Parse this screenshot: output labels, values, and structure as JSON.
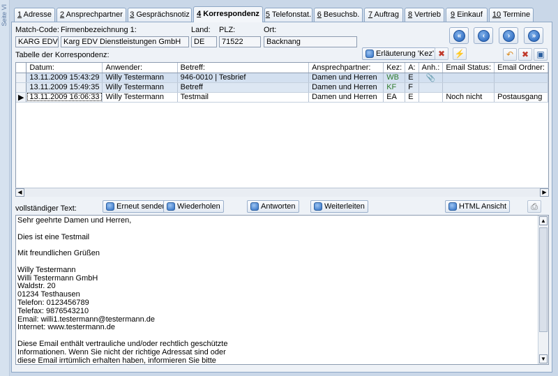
{
  "sidebar": {
    "vertical_text": "Seite VI"
  },
  "tabs": [
    {
      "num": "1",
      "label": "Adresse"
    },
    {
      "num": "2",
      "label": "Ansprechpartner"
    },
    {
      "num": "3",
      "label": "Gesprächsnotiz"
    },
    {
      "num": "4",
      "label": "Korrespondenz"
    },
    {
      "num": "5",
      "label": "Telefonstat."
    },
    {
      "num": "6",
      "label": "Besuchsb."
    },
    {
      "num": "7",
      "label": "Auftrag"
    },
    {
      "num": "8",
      "label": "Vertrieb"
    },
    {
      "num": "9",
      "label": "Einkauf"
    },
    {
      "num": "10",
      "label": "Termine"
    }
  ],
  "header": {
    "matchcode_label": "Match-Code:",
    "matchcode_value": "KARG EDV",
    "firma_label": "Firmenbezeichnung 1:",
    "firma_value": "Karg EDV Dienstleistungen GmbH",
    "land_label": "Land:",
    "land_value": "DE",
    "plz_label": "PLZ:",
    "plz_value": "71522",
    "ort_label": "Ort:",
    "ort_value": "Backnang"
  },
  "navigation": {
    "first": "first-record-icon",
    "prev": "previous-record-icon",
    "next": "next-record-icon",
    "last": "last-record-icon"
  },
  "table": {
    "title": "Tabelle der Korrespondenz:",
    "explain_button": "Erläuterung 'Kez'",
    "columns": [
      "Datum:",
      "Anwender:",
      "Betreff:",
      "Ansprechpartner:",
      "Kez:",
      "A:",
      "Anh.:",
      "Email Status:",
      "Email Ordner:"
    ],
    "rows": [
      {
        "datum": "13.11.2009 15:43:29",
        "anwender": "Willy Testermann",
        "betreff": "946-0010 | Tesbrief",
        "ansprechpartner": "Damen und Herren",
        "kez": "WB",
        "a": "E",
        "anh": "📎",
        "status": "",
        "ordner": ""
      },
      {
        "datum": "13.11.2009 15:49:35",
        "anwender": "Willy Testermann",
        "betreff": "Betreff",
        "ansprechpartner": "Damen und Herren",
        "kez": "KF",
        "a": "F",
        "anh": "",
        "status": "",
        "ordner": ""
      },
      {
        "datum": "13.11.2009 16:06:33",
        "anwender": "Willy Testermann",
        "betreff": "Testmail",
        "ansprechpartner": "Damen und Herren",
        "kez": "EA",
        "a": "E",
        "anh": "",
        "status": "Noch nicht",
        "ordner": "Postausgang"
      }
    ]
  },
  "text_section": {
    "label": "vollständiger Text:",
    "resend": "Erneut senden",
    "repeat": "Wiederholen",
    "reply": "Antworten",
    "forward": "Weiterleiten",
    "html_view": "HTML Ansicht",
    "body": "Sehr geehrte Damen und Herren,\n\nDies ist eine Testmail\n\nMit freundlichen Grüßen\n\nWilly Testermann\nWilli Testermann GmbH\nWaldstr. 20\n01234 Testhausen\nTelefon: 0123456789\nTelefax: 9876543210\nEmail: willi1.testermann@testermann.de\nInternet: www.testermann.de\n\nDiese Email enthält vertrauliche und/oder rechtlich geschützte\nInformationen. Wenn Sie nicht der richtige Adressat sind oder\ndiese Email irrtümlich erhalten haben, informieren Sie bitte"
  },
  "colors": {
    "accent": "#1e5eb8",
    "selected_row": "#d3e0f0",
    "background": "#c9d7e8"
  }
}
